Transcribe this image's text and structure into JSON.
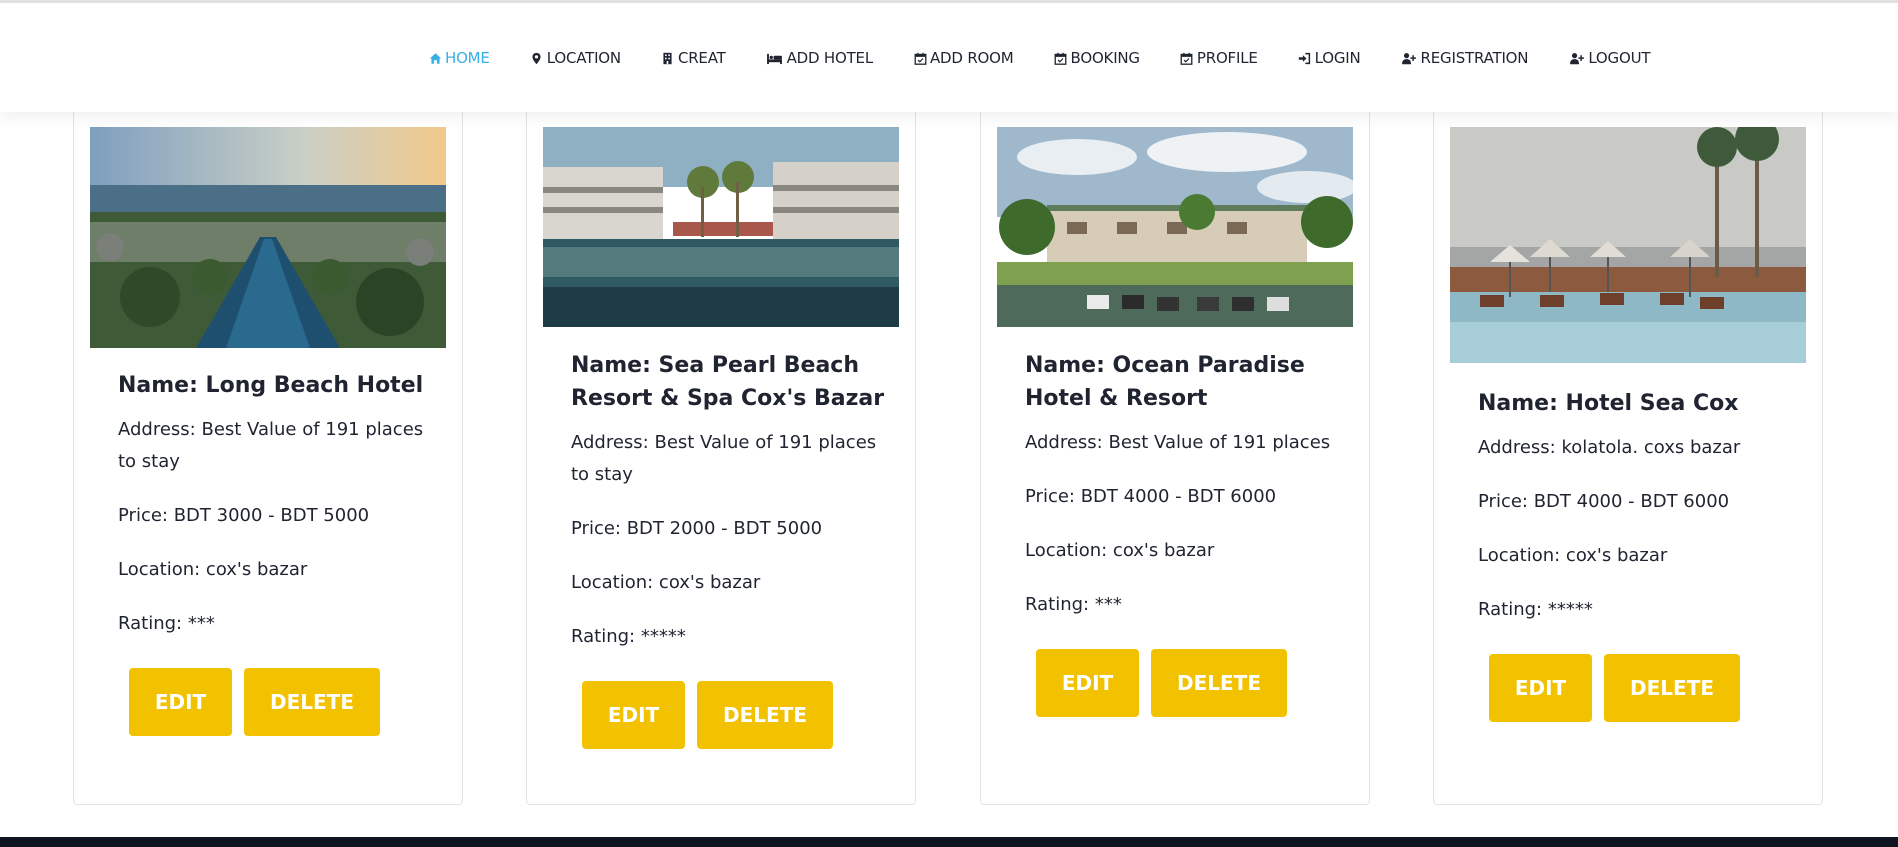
{
  "nav": {
    "items": [
      {
        "label": "HOME",
        "icon": "home-icon",
        "active": true
      },
      {
        "label": "LOCATION",
        "icon": "map-marker-icon"
      },
      {
        "label": "CREAT",
        "icon": "building-icon"
      },
      {
        "label": "ADD HOTEL",
        "icon": "bed-icon"
      },
      {
        "label": "ADD ROOM",
        "icon": "calendar-check-icon"
      },
      {
        "label": "BOOKING",
        "icon": "calendar-check-icon"
      },
      {
        "label": "PROFILE",
        "icon": "calendar-check-icon"
      },
      {
        "label": "LOGIN",
        "icon": "sign-in-icon"
      },
      {
        "label": "REGISTRATION",
        "icon": "user-plus-icon"
      },
      {
        "label": "LOGOUT",
        "icon": "user-plus-icon"
      }
    ],
    "active_color": "#37b0e6"
  },
  "hotels": [
    {
      "name": "Name: Long Beach Hotel",
      "address": "Address: Best Value of 191 places to stay",
      "price": "Price: BDT 3000 - BDT 5000",
      "location": "Location: cox's bazar",
      "rating": "Rating: ***",
      "image": "resort-aerial-pool-photo",
      "edit_label": "EDIT",
      "delete_label": "DELETE"
    },
    {
      "name": "Name: Sea Pearl Beach Resort & Spa Cox's Bazar",
      "address": "Address: Best Value of 191 places to stay",
      "price": "Price: BDT 2000 - BDT 5000",
      "location": "Location: cox's bazar",
      "rating": "Rating: *****",
      "image": "resort-reflection-pool-photo",
      "edit_label": "EDIT",
      "delete_label": "DELETE"
    },
    {
      "name": "Name: Ocean Paradise Hotel & Resort",
      "address": "Address: Best Value of 191 places",
      "price": "Price: BDT 4000 - BDT 6000",
      "location": "Location: cox's bazar",
      "rating": "Rating: ***",
      "image": "resort-jetski-dock-photo",
      "edit_label": "EDIT",
      "delete_label": "DELETE"
    },
    {
      "name": "Name: Hotel Sea Cox",
      "address": "Address: kolatola. coxs bazar",
      "price": "Price: BDT 4000 - BDT 6000",
      "location": "Location: cox's bazar",
      "rating": "Rating: *****",
      "image": "poolside-umbrellas-photo",
      "edit_label": "EDIT",
      "delete_label": "DELETE"
    }
  ],
  "colors": {
    "button": "#f2c100",
    "footer": "#0d1422"
  }
}
